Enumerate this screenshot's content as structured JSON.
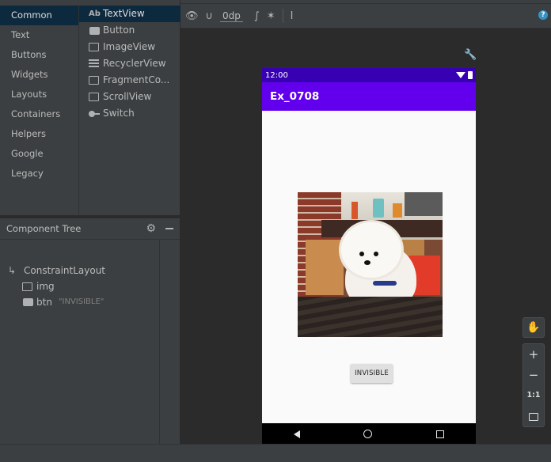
{
  "palette": {
    "categories": [
      "Common",
      "Text",
      "Buttons",
      "Widgets",
      "Layouts",
      "Containers",
      "Helpers",
      "Google",
      "Legacy"
    ],
    "selected_category": "Common",
    "widgets": [
      {
        "label": "TextView",
        "icon": "textview-icon",
        "glyph": "Ab"
      },
      {
        "label": "Button",
        "icon": "button-icon"
      },
      {
        "label": "ImageView",
        "icon": "imageview-icon"
      },
      {
        "label": "RecyclerView",
        "icon": "recyclerview-icon"
      },
      {
        "label": "FragmentCo...",
        "icon": "fragment-icon"
      },
      {
        "label": "ScrollView",
        "icon": "scrollview-icon"
      },
      {
        "label": "Switch",
        "icon": "switch-icon"
      }
    ]
  },
  "toolbar": {
    "margin_value": "0dp",
    "help": "?"
  },
  "component_tree": {
    "title": "Component Tree",
    "root": "ConstraintLayout",
    "children": [
      {
        "name": "img",
        "attr": ""
      },
      {
        "name": "btn",
        "attr": "\"INVISIBLE\""
      }
    ]
  },
  "device": {
    "status_time": "12:00",
    "app_title": "Ex_0708",
    "button_text": "INVISIBLE",
    "theme_primary": "#6200ee",
    "theme_dark": "#3700b3"
  },
  "zoom": {
    "plus": "+",
    "minus": "−",
    "one_to_one": "1:1"
  },
  "colors": {
    "selection": "#0d293e",
    "panel": "#3c3f41",
    "background": "#2b2b2b"
  }
}
